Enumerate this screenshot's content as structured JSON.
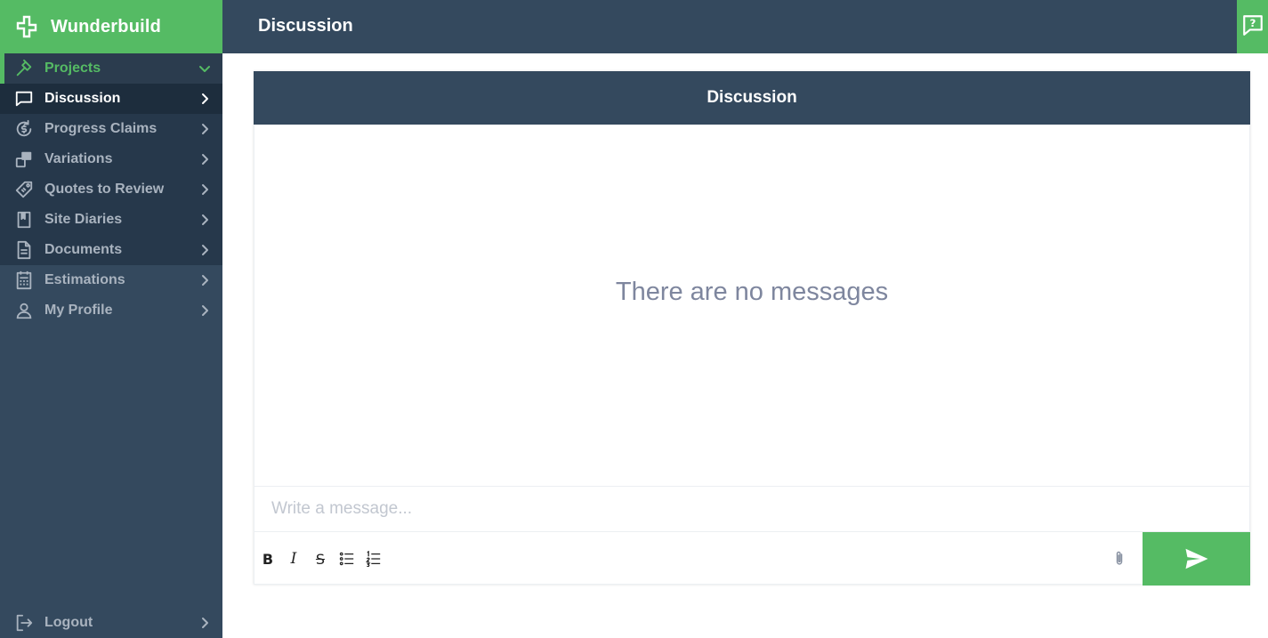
{
  "brand": {
    "name": "Wunderbuild",
    "icon": "wunderbuild-logo"
  },
  "topbar": {
    "title": "Discussion",
    "help_icon": "help-chat-icon"
  },
  "sidebar": {
    "projects": {
      "label": "Projects",
      "icon": "hammer-icon"
    },
    "items": [
      {
        "label": "Discussion",
        "icon": "chat-icon",
        "active": true
      },
      {
        "label": "Progress Claims",
        "icon": "progress-claims-icon"
      },
      {
        "label": "Variations",
        "icon": "variations-icon"
      },
      {
        "label": "Quotes to Review",
        "icon": "tag-icon"
      },
      {
        "label": "Site Diaries",
        "icon": "bookmark-book-icon"
      },
      {
        "label": "Documents",
        "icon": "document-icon"
      }
    ],
    "main_items": [
      {
        "label": "Estimations",
        "icon": "calculator-icon"
      },
      {
        "label": "My Profile",
        "icon": "user-icon"
      }
    ],
    "logout": {
      "label": "Logout",
      "icon": "logout-icon"
    }
  },
  "panel": {
    "header": "Discussion",
    "empty_message": "There are no messages",
    "input_placeholder": "Write a message...",
    "toolbar": {
      "bold": "B",
      "italic": "I",
      "strike": "S"
    }
  },
  "colors": {
    "brand_green": "#55bb64",
    "navy": "#34495e",
    "muted_text": "#7e869e"
  }
}
